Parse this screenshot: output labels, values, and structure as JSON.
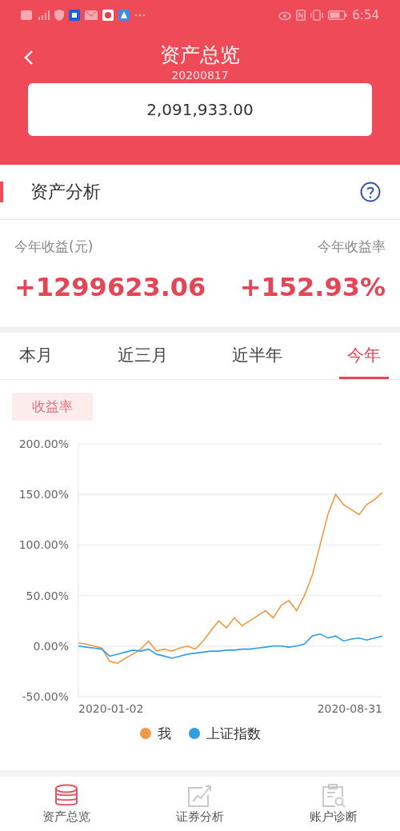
{
  "status_bar": {
    "time": "6:54"
  },
  "header": {
    "title": "资产总览",
    "date": "20200817",
    "total": "2,091,933.00"
  },
  "analysis": {
    "title": "资产分析",
    "profit_label": "今年收益(元)",
    "rate_label": "今年收益率",
    "profit": "+1299623.06",
    "rate": "+152.93%"
  },
  "tabs": [
    {
      "label": "本月",
      "selected": false
    },
    {
      "label": "近三月",
      "selected": false
    },
    {
      "label": "近半年",
      "selected": false
    },
    {
      "label": "今年",
      "selected": true
    }
  ],
  "metric_chip": "收益率",
  "chart_axis": {
    "start": "2020-01-02",
    "end": "2020-08-31"
  },
  "chart_data": {
    "type": "line",
    "grid": true,
    "ylim": [
      -50,
      200
    ],
    "yticks": [
      {
        "value": 200,
        "label": "200.00%"
      },
      {
        "value": 150,
        "label": "150.00%"
      },
      {
        "value": 100,
        "label": "100.00%"
      },
      {
        "value": 50,
        "label": "50.00%"
      },
      {
        "value": 0,
        "label": "0.00%"
      },
      {
        "value": -50,
        "label": "-50.00%"
      }
    ],
    "series": [
      {
        "name": "我",
        "color": "#ee9a45",
        "values": [
          3,
          2,
          0,
          -2,
          -15,
          -17,
          -12,
          -8,
          -3,
          5,
          -5,
          -3,
          -5,
          -2,
          0,
          -3,
          5,
          15,
          25,
          18,
          28,
          20,
          25,
          30,
          35,
          28,
          40,
          45,
          35,
          50,
          70,
          100,
          130,
          150,
          140,
          135,
          130,
          140,
          145,
          152
        ]
      },
      {
        "name": "上证指数",
        "color": "#2f9de4",
        "values": [
          0,
          -1,
          -2,
          -3,
          -10,
          -8,
          -6,
          -4,
          -5,
          -3,
          -8,
          -10,
          -12,
          -10,
          -8,
          -7,
          -6,
          -5,
          -5,
          -4,
          -4,
          -3,
          -3,
          -2,
          -1,
          0,
          0,
          -1,
          0,
          2,
          10,
          12,
          8,
          10,
          5,
          7,
          8,
          6,
          8,
          10
        ]
      }
    ]
  },
  "nav": [
    {
      "label": "资产总览",
      "selected": true
    },
    {
      "label": "证券分析",
      "selected": false
    },
    {
      "label": "账户诊断",
      "selected": false
    }
  ]
}
